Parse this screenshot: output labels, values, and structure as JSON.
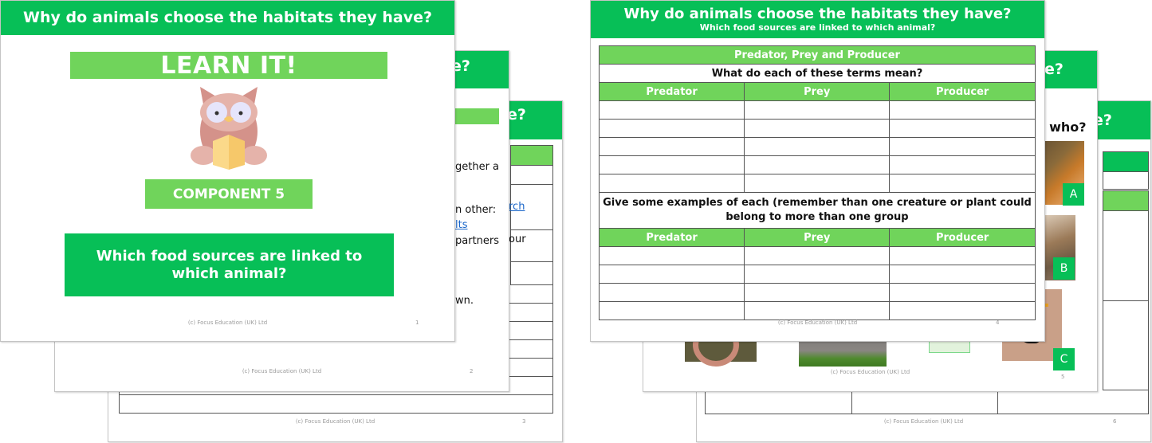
{
  "colors": {
    "header_green": "#07bf57",
    "light_green": "#70d45b",
    "link_blue": "#1a66c9",
    "footer_grey": "#9a9a9a"
  },
  "copyright": "(c) Focus Education (UK) Ltd",
  "slides": [
    {
      "number": "1",
      "header": "Why do animals choose the habitats they have?",
      "banner": "LEARN IT!",
      "illustration": "owl-reading-book-icon",
      "component": "COMPONENT 5",
      "question": "Which food sources are linked to which animal?"
    },
    {
      "number": "2",
      "header_fragment": "e?",
      "text_fragments": [
        "gether a",
        "n other:",
        "lts",
        "partners",
        "wn."
      ]
    },
    {
      "number": "3",
      "header_fragment": "e?",
      "text_fragments": [
        "rch",
        "our"
      ]
    },
    {
      "number": "4",
      "header": "Why do animals choose the habitats they have?",
      "subheader": "Which food sources are linked to which animal?",
      "table_title": "Predator, Prey and Producer",
      "prompt1": "What do each of these terms mean?",
      "columns": [
        "Predator",
        "Prey",
        "Producer"
      ],
      "prompt2": "Give some examples of each (remember than one creature or plant could belong to more than one group",
      "rows_section1": 5,
      "rows_section2": 4
    },
    {
      "number": "5",
      "header_fragment": "e?",
      "text_fragment": "s who?",
      "photos": [
        {
          "label": "A",
          "subject": "fox"
        },
        {
          "label": "B",
          "subject": "cat"
        },
        {
          "label": "C",
          "subject": "blackbird"
        },
        {
          "label": "",
          "subject": "earthworm"
        },
        {
          "label": "",
          "subject": "rabbit"
        }
      ]
    },
    {
      "number": "6",
      "header_fragment": "e?"
    }
  ]
}
